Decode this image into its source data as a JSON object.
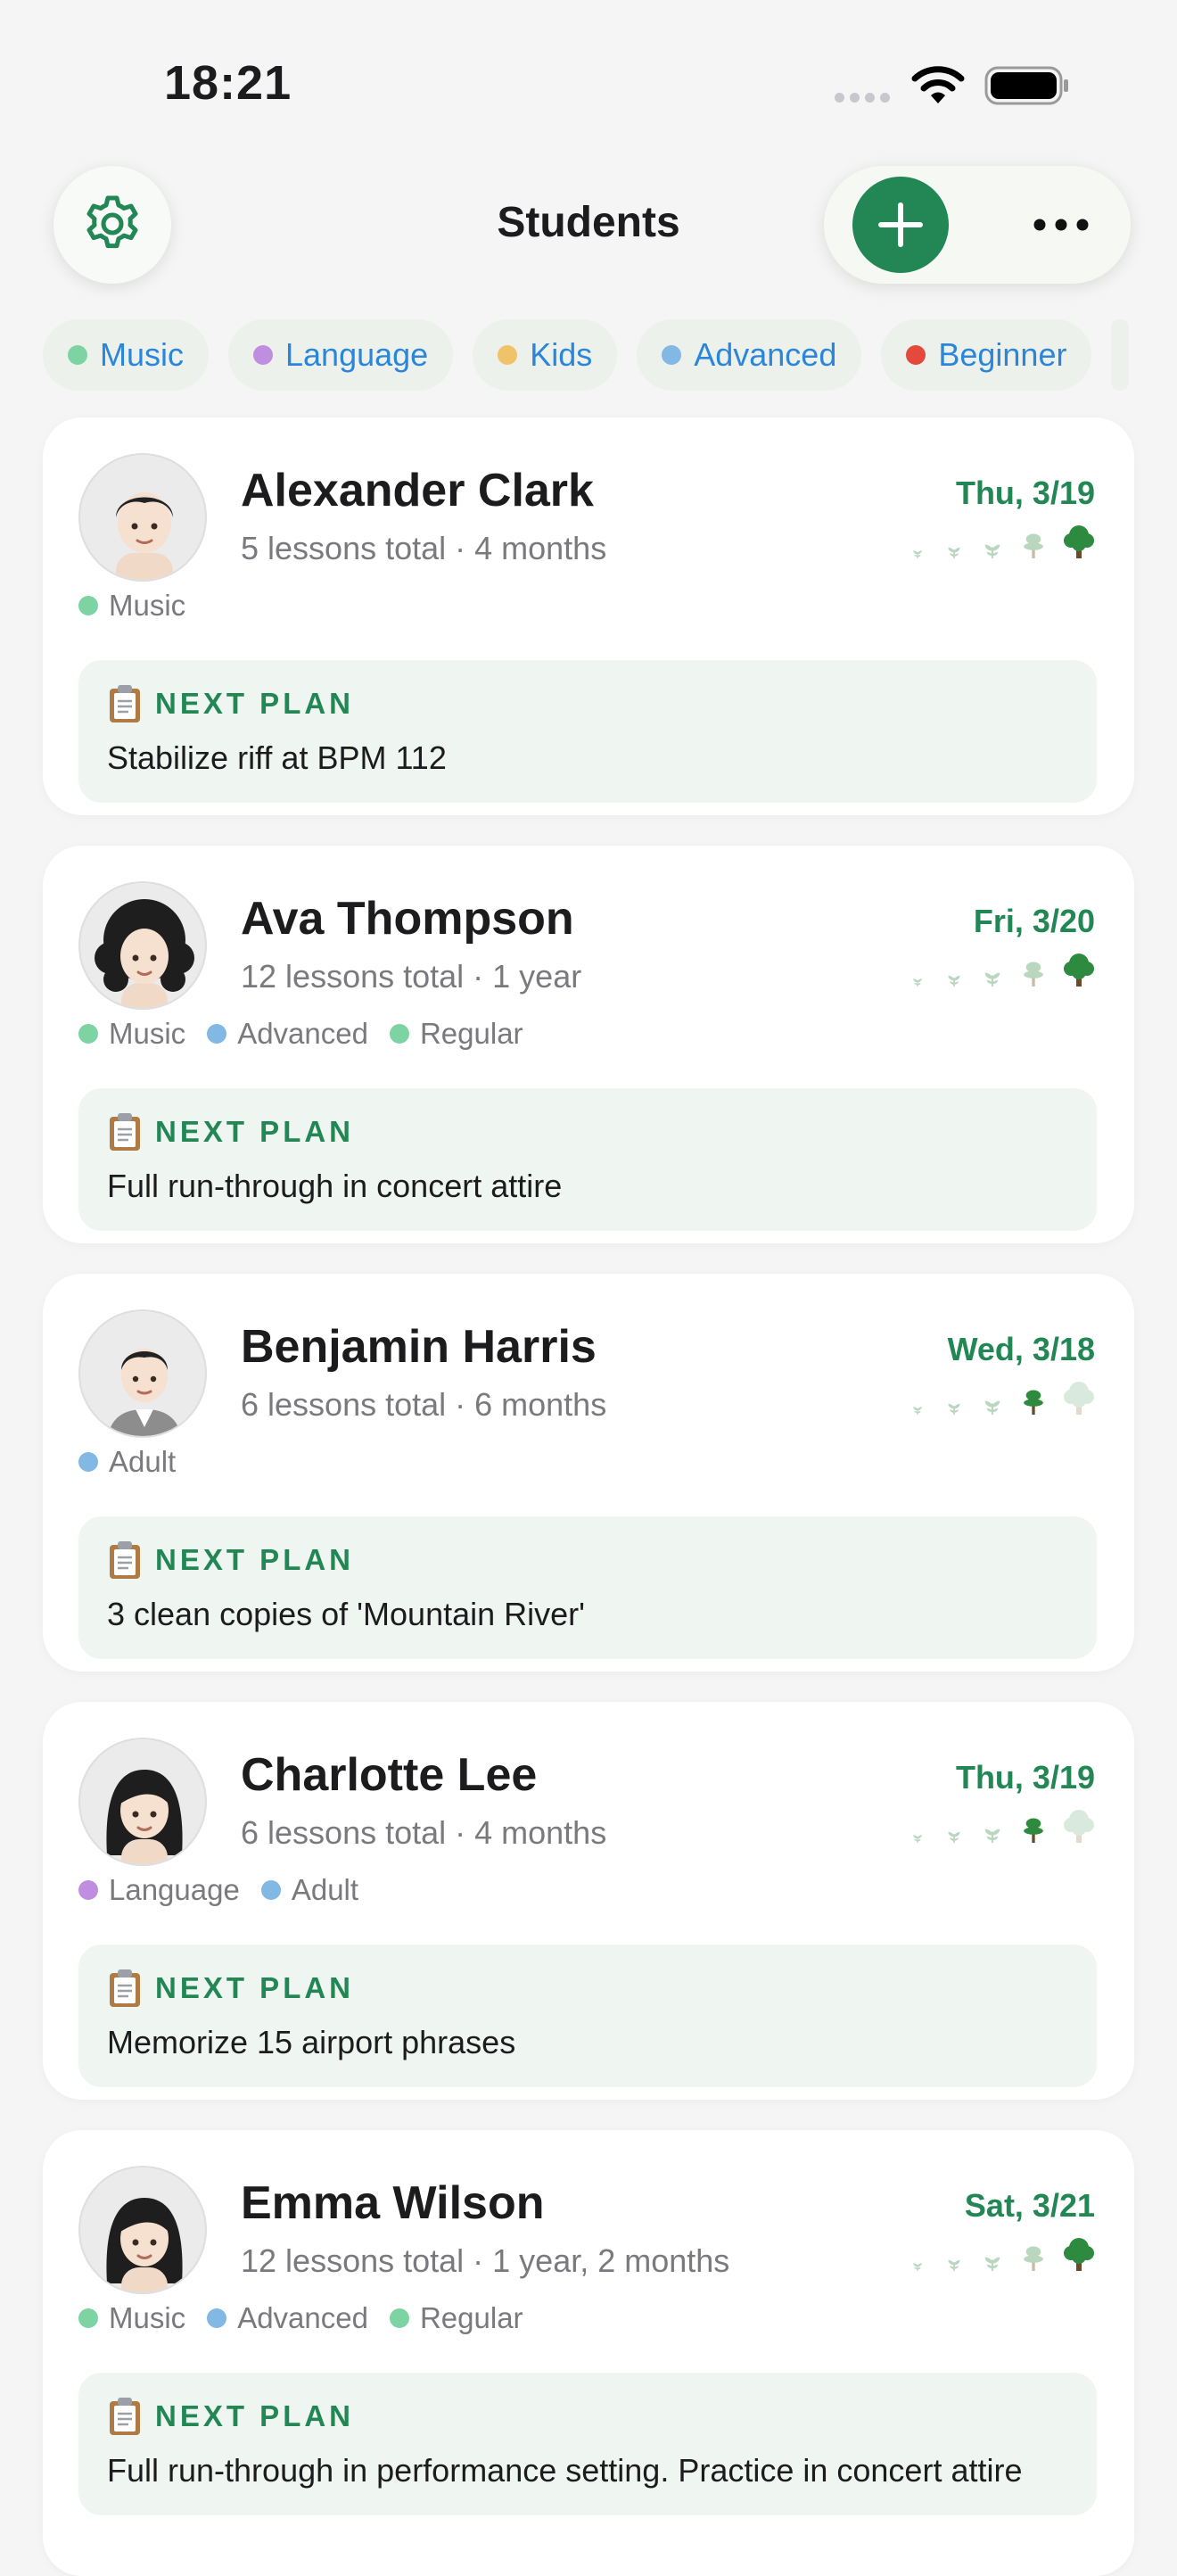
{
  "status_bar": {
    "time": "18:21"
  },
  "header": {
    "title": "Students",
    "settings_icon": "gear-icon",
    "add_icon": "plus-icon",
    "more_icon": "ellipsis-icon"
  },
  "filters": [
    {
      "label": "Music",
      "color": "#7ed3a3"
    },
    {
      "label": "Language",
      "color": "#c08ee0"
    },
    {
      "label": "Kids",
      "color": "#f0c26a"
    },
    {
      "label": "Advanced",
      "color": "#82b8e4"
    },
    {
      "label": "Beginner",
      "color": "#e34a3b"
    }
  ],
  "plan_label": "NEXT PLAN",
  "students": [
    {
      "name": "Alexander Clark",
      "meta": "5 lessons total · 4 months",
      "date": "Thu, 3/19",
      "growth_stage": 5,
      "avatar": "boy-avatar",
      "tags": [
        {
          "label": "Music",
          "color": "#7ed3a3"
        }
      ],
      "plan": "Stabilize riff at BPM 112"
    },
    {
      "name": "Ava Thompson",
      "meta": "12 lessons total · 1 year",
      "date": "Fri, 3/20",
      "growth_stage": 5,
      "avatar": "curly-hair-woman-avatar",
      "tags": [
        {
          "label": "Music",
          "color": "#7ed3a3"
        },
        {
          "label": "Advanced",
          "color": "#82b8e4"
        },
        {
          "label": "Regular",
          "color": "#7ed3a3"
        }
      ],
      "plan": "Full run-through in concert attire"
    },
    {
      "name": "Benjamin Harris",
      "meta": "6 lessons total · 6 months",
      "date": "Wed, 3/18",
      "growth_stage": 4,
      "avatar": "man-in-suit-avatar",
      "tags": [
        {
          "label": "Adult",
          "color": "#82b8e4"
        }
      ],
      "plan": "3 clean copies of 'Mountain River'"
    },
    {
      "name": "Charlotte Lee",
      "meta": "6 lessons total · 4 months",
      "date": "Thu, 3/19",
      "growth_stage": 4,
      "avatar": "woman-avatar",
      "tags": [
        {
          "label": "Language",
          "color": "#c08ee0"
        },
        {
          "label": "Adult",
          "color": "#82b8e4"
        }
      ],
      "plan": "Memorize 15 airport phrases"
    },
    {
      "name": "Emma Wilson",
      "meta": "12 lessons total · 1 year, 2 months",
      "date": "Sat, 3/21",
      "growth_stage": 5,
      "avatar": "woman-avatar",
      "tags": [
        {
          "label": "Music",
          "color": "#7ed3a3"
        },
        {
          "label": "Advanced",
          "color": "#82b8e4"
        },
        {
          "label": "Regular",
          "color": "#7ed3a3"
        }
      ],
      "plan": "Full run-through in performance setting. Practice in concert attire"
    }
  ]
}
